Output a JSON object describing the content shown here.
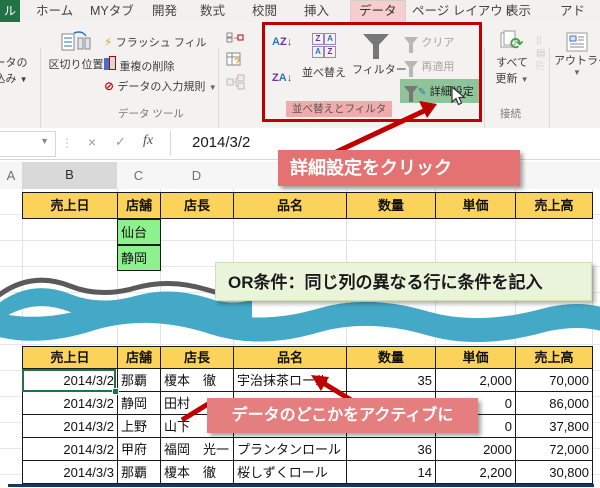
{
  "tab_bar": {
    "file_tab": "ル",
    "tabs": [
      "ホーム",
      "MYタブ",
      "開発",
      "数式",
      "校閲",
      "挿入",
      "データ",
      "ページ レイアウト",
      "表示",
      "アド"
    ],
    "active_tab": "データ"
  },
  "ribbon": {
    "get_external_fragment_1": "ータの",
    "get_external_fragment_2": "込み",
    "text_to_columns": "区切り位置",
    "flash_fill": "フラッシュ フィル",
    "remove_duplicates": "重複の削除",
    "data_validation": "データの入力規則",
    "data_tools_group": "データ ツール",
    "sort_button": "並べ替え",
    "filter_button": "フィルター",
    "clear_button": "クリア",
    "reapply_button": "再適用",
    "advanced_button": "詳細設定",
    "sort_filter_group": "並べ替えとフィルタ",
    "refresh_all_line1": "すべて",
    "refresh_all_line2": "更新",
    "connections_group": "接続",
    "outline_button": "アウトライン"
  },
  "formula_bar": {
    "value": "2014/3/2",
    "fx_label": "fx"
  },
  "column_headers": [
    "A",
    "B",
    "C",
    "D"
  ],
  "callouts": {
    "advanced_click": "詳細設定をクリック",
    "or_condition": "OR条件：同じ列の異なる行に条件を記入",
    "activate_data": "データのどこかをアクティブに"
  },
  "criteria_table": {
    "headers": [
      "売上日",
      "店舗",
      "店長",
      "品名",
      "数量",
      "単価",
      "売上高"
    ],
    "criteria_values": [
      "仙台",
      "静岡"
    ]
  },
  "data_table": {
    "headers": [
      "売上日",
      "店舗",
      "店長",
      "品名",
      "数量",
      "単価",
      "売上高"
    ],
    "rows": [
      [
        "2014/3/2",
        "那覇",
        "榎本　徹",
        "宇治抹茶ロール",
        "35",
        "2,000",
        "70,000"
      ],
      [
        "2014/3/2",
        "静岡",
        "田村",
        "",
        "",
        "0",
        "86,000"
      ],
      [
        "2014/3/2",
        "上野",
        "山下",
        "",
        "",
        "0",
        "37,800"
      ],
      [
        "2014/3/2",
        "甲府",
        "福岡　光一",
        "プランタンロール",
        "36",
        "2000",
        "72,000"
      ],
      [
        "2014/3/3",
        "那覇",
        "榎本　徹",
        "桜しずくロール",
        "14",
        "2,200",
        "30,800"
      ]
    ]
  },
  "colors": {
    "excel_green": "#217346",
    "header_yellow": "#fbd35b",
    "criteria_green": "#8df28d",
    "wave_teal": "#43a9c7",
    "callout_red": "#e57a7a",
    "callout_green_bg": "#eaf4db",
    "advanced_highlight_green": "#8fc49a",
    "annotation_red": "#c00000",
    "tab_active_pink": "#f8cdcd",
    "group_label_pink": "#f2abab"
  }
}
